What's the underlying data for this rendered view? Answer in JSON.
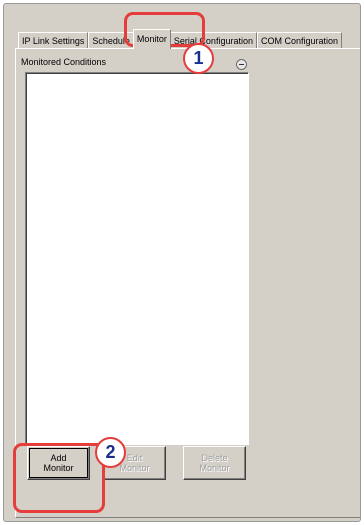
{
  "tabs": [
    {
      "label": "IP Link Settings",
      "active": false
    },
    {
      "label": "Schedule",
      "active": false
    },
    {
      "label": "Monitor",
      "active": true
    },
    {
      "label": "Serial Configuration",
      "active": false
    },
    {
      "label": "COM Configuration",
      "active": false
    }
  ],
  "section": {
    "title": "Monitored Conditions",
    "collapse_icon": "minus-circle-icon"
  },
  "buttons": {
    "add": {
      "line1": "Add",
      "line2": "Monitor",
      "enabled": true
    },
    "edit": {
      "line1": "Edit",
      "line2": "Monitor",
      "enabled": false
    },
    "delete": {
      "line1": "Delete",
      "line2": "Monitor",
      "enabled": false
    }
  },
  "callouts": {
    "one": "1",
    "two": "2"
  },
  "colors": {
    "callout_red": "#e53c3c",
    "callout_number": "#1a2e8c",
    "dialog_gray": "#d4d0c8"
  }
}
